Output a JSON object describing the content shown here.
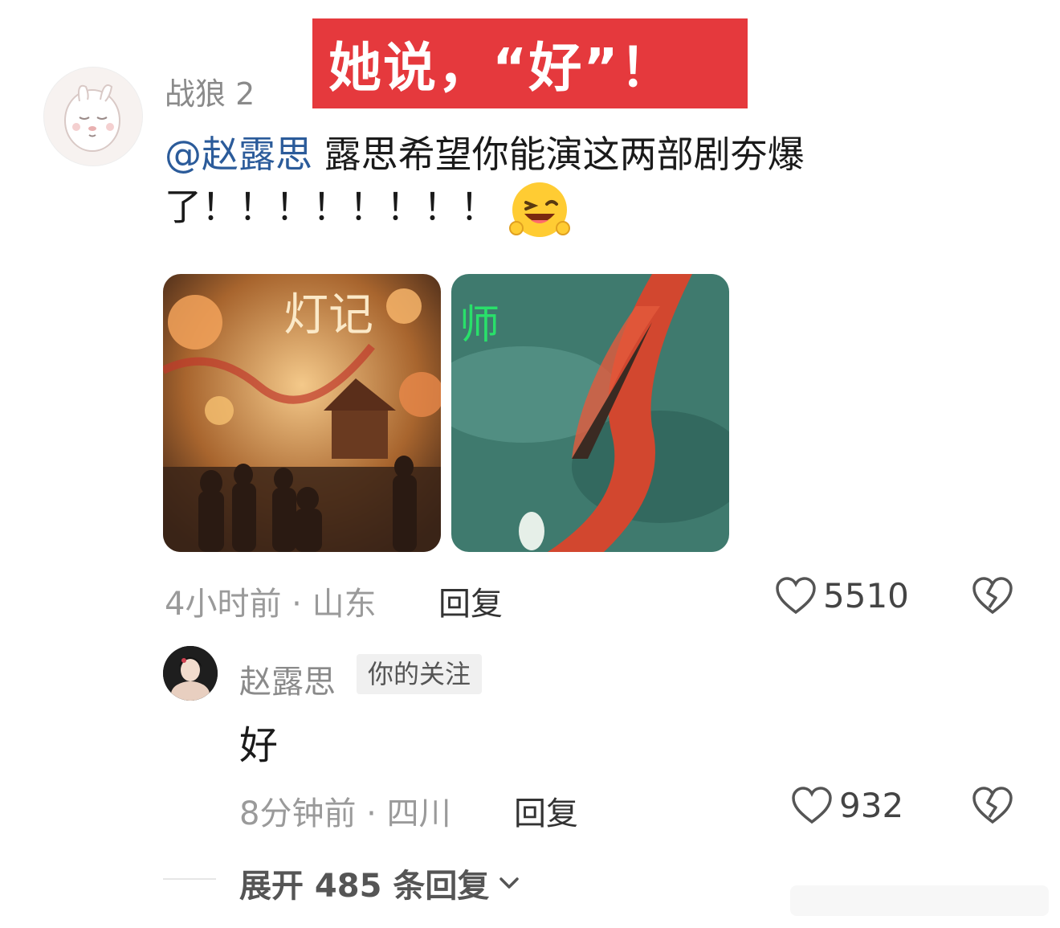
{
  "banner": {
    "text": "她说，“好”！"
  },
  "comment1": {
    "username": "战狼 2",
    "mention": "@赵露思",
    "text": " 露思希望你能演这两部剧夯爆了！！！！！！！！",
    "meta": "4小时前 · 山东",
    "reply_label": "回复",
    "like_count": "5510",
    "posters": [
      {
        "title": "灯记",
        "icon": "poster-image"
      },
      {
        "title": "师",
        "icon": "poster-image"
      }
    ]
  },
  "comment2": {
    "username": "赵露思",
    "badge": "你的关注",
    "text": "好",
    "meta": "8分钟前 · 四川",
    "reply_label": "回复",
    "like_count": "932"
  },
  "expand": {
    "label": "展开 485 条回复"
  },
  "colors": {
    "banner": "#e5393d",
    "mention": "#2b5b9a"
  }
}
